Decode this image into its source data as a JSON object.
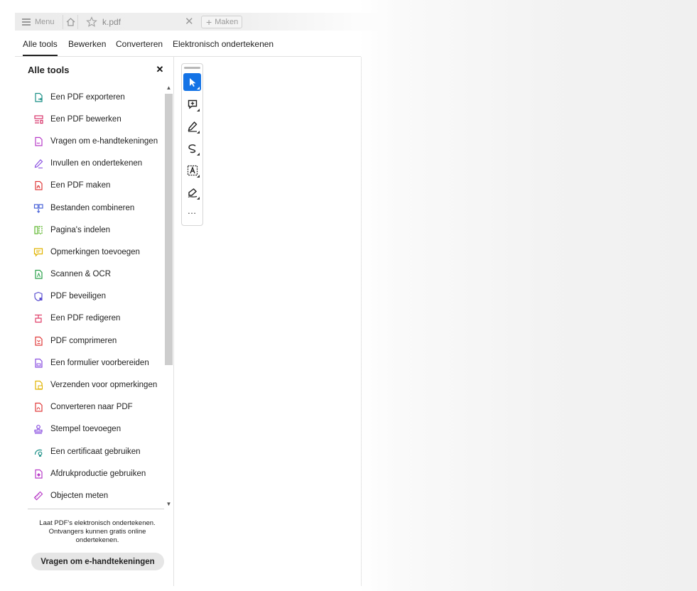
{
  "tabstrip": {
    "menu_label": "Menu",
    "doc_name": "k.pdf",
    "close_glyph": "✕",
    "new_tab_plus": "+",
    "new_tab_label": "Maken"
  },
  "mode_tabs": [
    {
      "label": "Alle tools",
      "active": true
    },
    {
      "label": "Bewerken",
      "active": false
    },
    {
      "label": "Converteren",
      "active": false
    },
    {
      "label": "Elektronisch ondertekenen",
      "active": false
    }
  ],
  "panel": {
    "title": "Alle tools",
    "close_glyph": "✕",
    "tools": [
      {
        "label": "Een PDF exporteren",
        "icon": "export-pdf-icon",
        "color": "#1a8f86"
      },
      {
        "label": "Een PDF bewerken",
        "icon": "edit-pdf-icon",
        "color": "#d8336a"
      },
      {
        "label": "Vragen om e-handtekeningen",
        "icon": "request-esign-icon",
        "color": "#b83cc8"
      },
      {
        "label": "Invullen en ondertekenen",
        "icon": "fill-sign-icon",
        "color": "#8a4fe0"
      },
      {
        "label": "Een PDF maken",
        "icon": "create-pdf-icon",
        "color": "#e03b3b"
      },
      {
        "label": "Bestanden combineren",
        "icon": "combine-files-icon",
        "color": "#4a63d8"
      },
      {
        "label": "Pagina's indelen",
        "icon": "organize-pages-icon",
        "color": "#5fb82f"
      },
      {
        "label": "Opmerkingen toevoegen",
        "icon": "comment-icon",
        "color": "#e1b300"
      },
      {
        "label": "Scannen & OCR",
        "icon": "scan-ocr-icon",
        "color": "#2aa04a"
      },
      {
        "label": "PDF beveiligen",
        "icon": "protect-pdf-icon",
        "color": "#5b4fd0"
      },
      {
        "label": "Een PDF redigeren",
        "icon": "redact-pdf-icon",
        "color": "#e0406a"
      },
      {
        "label": "PDF comprimeren",
        "icon": "compress-pdf-icon",
        "color": "#e03b3b"
      },
      {
        "label": "Een formulier voorbereiden",
        "icon": "prepare-form-icon",
        "color": "#8a4fe0"
      },
      {
        "label": "Verzenden voor opmerkingen",
        "icon": "send-comments-icon",
        "color": "#e1b300"
      },
      {
        "label": "Converteren naar PDF",
        "icon": "convert-pdf-icon",
        "color": "#e03b3b"
      },
      {
        "label": "Stempel toevoegen",
        "icon": "stamp-icon",
        "color": "#8a4fe0"
      },
      {
        "label": "Een certificaat gebruiken",
        "icon": "certificate-icon",
        "color": "#1a8f86"
      },
      {
        "label": "Afdrukproductie gebruiken",
        "icon": "print-production-icon",
        "color": "#b83cc8"
      },
      {
        "label": "Objecten meten",
        "icon": "measure-icon",
        "color": "#b83cc8"
      }
    ],
    "promo_text": "Laat PDF's elektronisch ondertekenen. Ontvangers kunnen gratis online ondertekenen.",
    "promo_button": "Vragen om e-handtekeningen"
  },
  "toolbar": {
    "more_glyph": "…",
    "accent": "#1473e6",
    "tools": [
      "select-cursor-icon",
      "add-comment-icon",
      "highlight-pen-icon",
      "freehand-draw-icon",
      "text-recognition-icon",
      "sign-icon"
    ]
  }
}
